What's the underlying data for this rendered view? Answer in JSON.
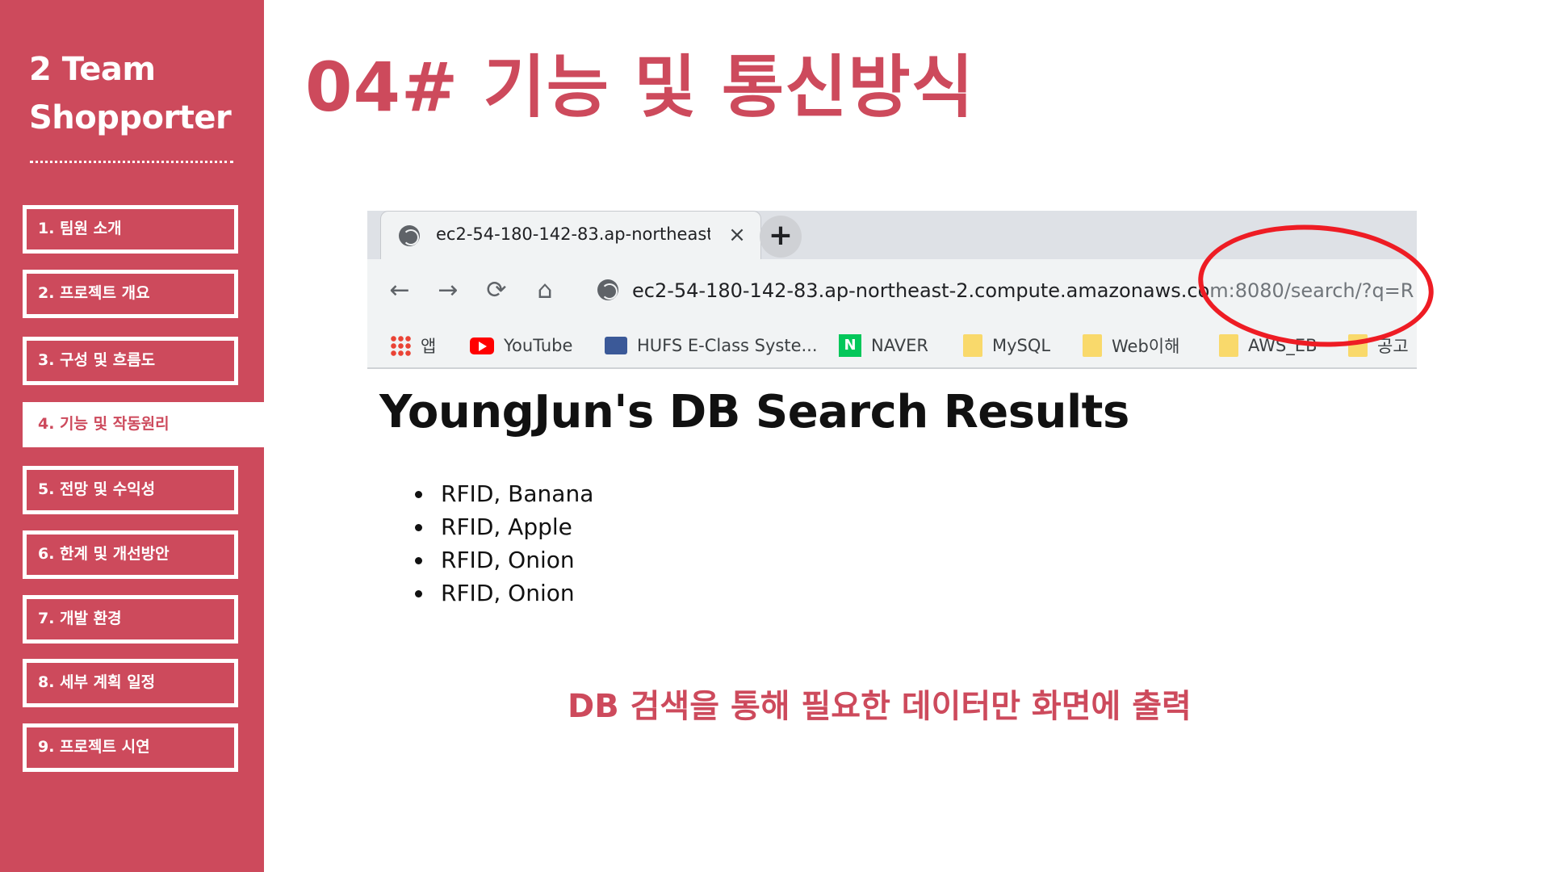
{
  "sidebar": {
    "team_line1": "2 Team",
    "team_line2": "Shopporter",
    "items": [
      {
        "label": "1. 팀원 소개"
      },
      {
        "label": "2. 프로젝트 개요"
      },
      {
        "label": "3. 구성 및 흐름도"
      },
      {
        "label": "4. 기능 및 작동원리"
      },
      {
        "label": "5. 전망 및 수익성"
      },
      {
        "label": "6. 한계 및 개선방안"
      },
      {
        "label": "7. 개발 환경"
      },
      {
        "label": "8. 세부 계획 일정"
      },
      {
        "label": "9. 프로젝트 시연"
      }
    ],
    "active_index": 3
  },
  "slide": {
    "title": "04# 기능 및 통신방식",
    "caption": "DB 검색을 통해 필요한 데이터만 화면에 출력"
  },
  "browser": {
    "tab_title": "ec2-54-180-142-83.ap-northeast",
    "tab_close": "×",
    "new_tab": "+",
    "url_host": "ec2-54-180-142-83.ap-northeast-2.compute.amazonaws.co",
    "url_path": "m:8080/search/?q=R",
    "nav": {
      "back": "←",
      "forward": "→",
      "reload": "⟳",
      "home": "⌂"
    },
    "bookmarks": [
      {
        "label": "앱",
        "icon": "apps-icon"
      },
      {
        "label": "YouTube",
        "icon": "youtube-icon"
      },
      {
        "label": "HUFS E-Class Syste...",
        "icon": "hufs-icon"
      },
      {
        "label": "NAVER",
        "icon": "naver-icon"
      },
      {
        "label": "MySQL",
        "icon": "folder-icon"
      },
      {
        "label": "Web이해",
        "icon": "folder-icon"
      },
      {
        "label": "AWS_EB",
        "icon": "folder-icon"
      },
      {
        "label": "공고",
        "icon": "folder-icon"
      }
    ],
    "naver_letter": "N"
  },
  "page": {
    "heading": "YoungJun's DB Search Results",
    "results": [
      "RFID, Banana",
      "RFID, Apple",
      "RFID, Onion",
      "RFID, Onion"
    ]
  },
  "colors": {
    "brand": "#cd4a5c",
    "highlight_ellipse": "#ee1c24"
  }
}
